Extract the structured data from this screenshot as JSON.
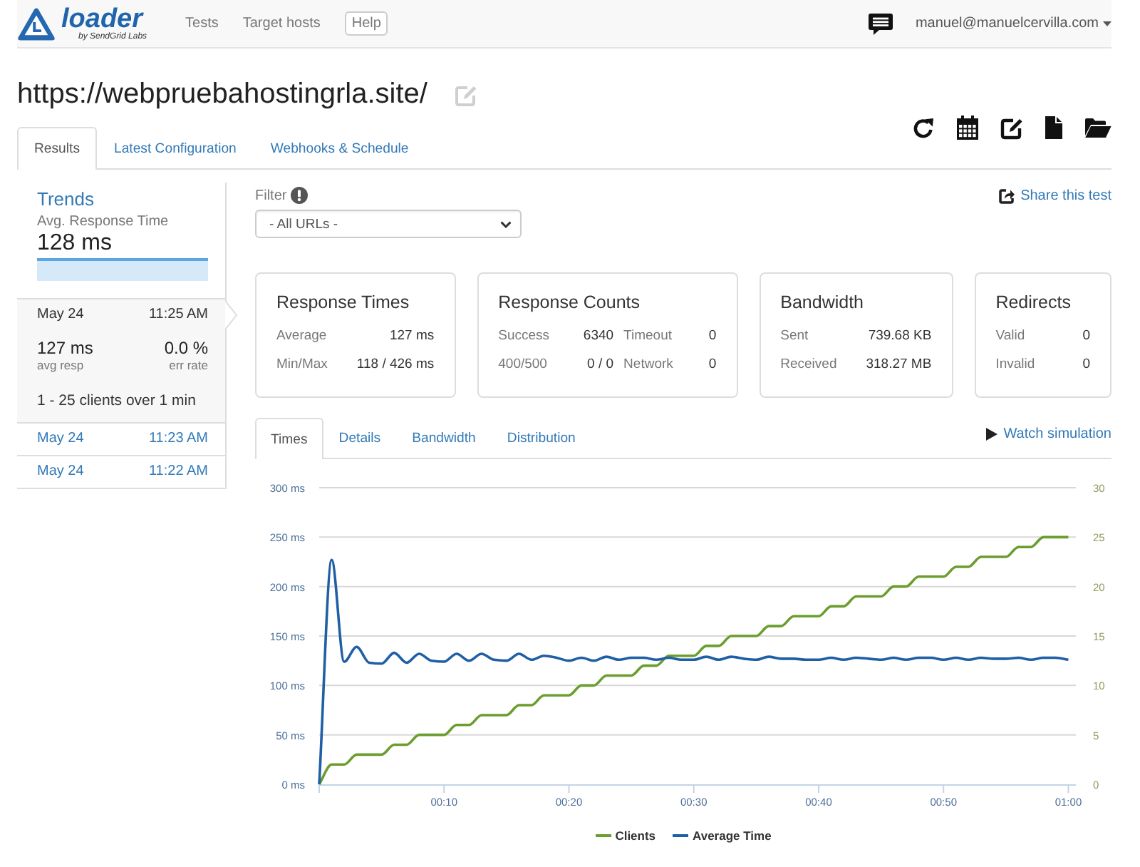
{
  "navbar": {
    "logo": {
      "name": "loader",
      "tagline": "by SendGrid Labs"
    },
    "links": [
      {
        "label": "Tests",
        "kind": "link"
      },
      {
        "label": "Target hosts",
        "kind": "link"
      },
      {
        "label": "Help",
        "kind": "button"
      }
    ],
    "user": "manuel@manuelcervilla.com"
  },
  "title": "https://webpruebahostingrla.site/",
  "tabs": [
    {
      "label": "Results",
      "selected": true
    },
    {
      "label": "Latest Configuration",
      "selected": false
    },
    {
      "label": "Webhooks & Schedule",
      "selected": false
    }
  ],
  "sidebar": {
    "heading": "Trends",
    "metric_label": "Avg. Response Time",
    "metric_value": "128 ms",
    "runs": [
      {
        "date": "May 24",
        "time": "11:25 AM",
        "selected": true,
        "stats": [
          {
            "value": "127 ms",
            "label": "avg resp"
          },
          {
            "value": "0.0 %",
            "label": "err rate"
          }
        ],
        "summary": "1 - 25 clients over 1 min"
      },
      {
        "date": "May 24",
        "time": "11:23 AM",
        "selected": false
      },
      {
        "date": "May 24",
        "time": "11:22 AM",
        "selected": false
      }
    ]
  },
  "filter": {
    "label": "Filter",
    "value": "- All URLs -"
  },
  "share_link": "Share this test",
  "cards": [
    {
      "title": "Response Times",
      "rows": [
        [
          {
            "label": "Average",
            "value": "127 ms"
          }
        ],
        [
          {
            "label": "Min/Max",
            "value": "118 / 426 ms"
          }
        ]
      ]
    },
    {
      "title": "Response Counts",
      "rows": [
        [
          {
            "label": "Success",
            "value": "6340"
          },
          {
            "label": "Timeout",
            "value": "0"
          }
        ],
        [
          {
            "label": "400/500",
            "value": "0 / 0"
          },
          {
            "label": "Network",
            "value": "0"
          }
        ]
      ]
    },
    {
      "title": "Bandwidth",
      "rows": [
        [
          {
            "label": "Sent",
            "value": "739.68 KB"
          }
        ],
        [
          {
            "label": "Received",
            "value": "318.27 MB"
          }
        ]
      ]
    },
    {
      "title": "Redirects",
      "rows": [
        [
          {
            "label": "Valid",
            "value": "0"
          }
        ],
        [
          {
            "label": "Invalid",
            "value": "0"
          }
        ]
      ]
    }
  ],
  "chart_tabs": [
    {
      "label": "Times",
      "selected": true
    },
    {
      "label": "Details",
      "selected": false
    },
    {
      "label": "Bandwidth",
      "selected": false
    },
    {
      "label": "Distribution",
      "selected": false
    }
  ],
  "watch_link": "Watch simulation",
  "chart": {
    "chart_data": {
      "type": "line",
      "x": [
        0,
        1,
        2,
        3,
        4,
        5,
        6,
        7,
        8,
        9,
        10,
        11,
        12,
        13,
        14,
        15,
        16,
        17,
        18,
        19,
        20,
        21,
        22,
        23,
        24,
        25,
        26,
        27,
        28,
        29,
        30,
        31,
        32,
        33,
        34,
        35,
        36,
        37,
        38,
        39,
        40,
        41,
        42,
        43,
        44,
        45,
        46,
        47,
        48,
        49,
        50,
        51,
        52,
        53,
        54,
        55,
        56,
        57,
        58,
        59,
        60
      ],
      "xlim": [
        0,
        60.6
      ],
      "xticks": [
        {
          "value": 10,
          "label": "00:10"
        },
        {
          "value": 20,
          "label": "00:20"
        },
        {
          "value": 30,
          "label": "00:30"
        },
        {
          "value": 40,
          "label": "00:40"
        },
        {
          "value": 50,
          "label": "00:50"
        },
        {
          "value": 60,
          "label": "01:00"
        }
      ],
      "ylim": [
        0,
        300
      ],
      "yticks": [
        {
          "value": 0,
          "label": "0 ms"
        },
        {
          "value": 50,
          "label": "50 ms"
        },
        {
          "value": 100,
          "label": "100 ms"
        },
        {
          "value": 150,
          "label": "150 ms"
        },
        {
          "value": 200,
          "label": "200 ms"
        },
        {
          "value": 250,
          "label": "250 ms"
        },
        {
          "value": 300,
          "label": "300 ms"
        }
      ],
      "y2lim": [
        0,
        30
      ],
      "y2ticks": [
        0,
        5,
        10,
        15,
        20,
        25,
        30
      ],
      "grid": true,
      "legend": true,
      "series": [
        {
          "name": "Clients",
          "color": "#6b9d2f",
          "axis": "y2",
          "values": [
            0,
            2,
            2,
            3,
            3,
            3,
            4,
            4,
            5,
            5,
            5,
            6,
            6,
            7,
            7,
            7,
            8,
            8,
            9,
            9,
            9,
            10,
            10,
            11,
            11,
            11,
            12,
            12,
            13,
            13,
            13,
            14,
            14,
            15,
            15,
            15,
            16,
            16,
            17,
            17,
            17,
            18,
            18,
            19,
            19,
            19,
            20,
            20,
            21,
            21,
            21,
            22,
            22,
            23,
            23,
            23,
            24,
            24,
            25,
            25,
            25
          ]
        },
        {
          "name": "Average Time",
          "color": "#1f5fa5",
          "values": [
            0,
            227,
            124,
            139,
            123,
            122,
            133,
            123,
            132,
            125,
            124,
            132,
            125,
            132,
            126,
            125,
            132,
            126,
            130,
            128,
            125,
            128,
            125,
            129,
            126,
            128,
            128,
            126,
            128,
            126,
            126,
            129,
            126,
            129,
            127,
            126,
            129,
            127,
            127,
            126,
            126,
            128,
            126,
            128,
            127,
            126,
            128,
            126,
            128,
            128,
            126,
            128,
            126,
            128,
            127,
            127,
            128,
            126,
            128,
            128,
            126
          ]
        }
      ]
    }
  }
}
